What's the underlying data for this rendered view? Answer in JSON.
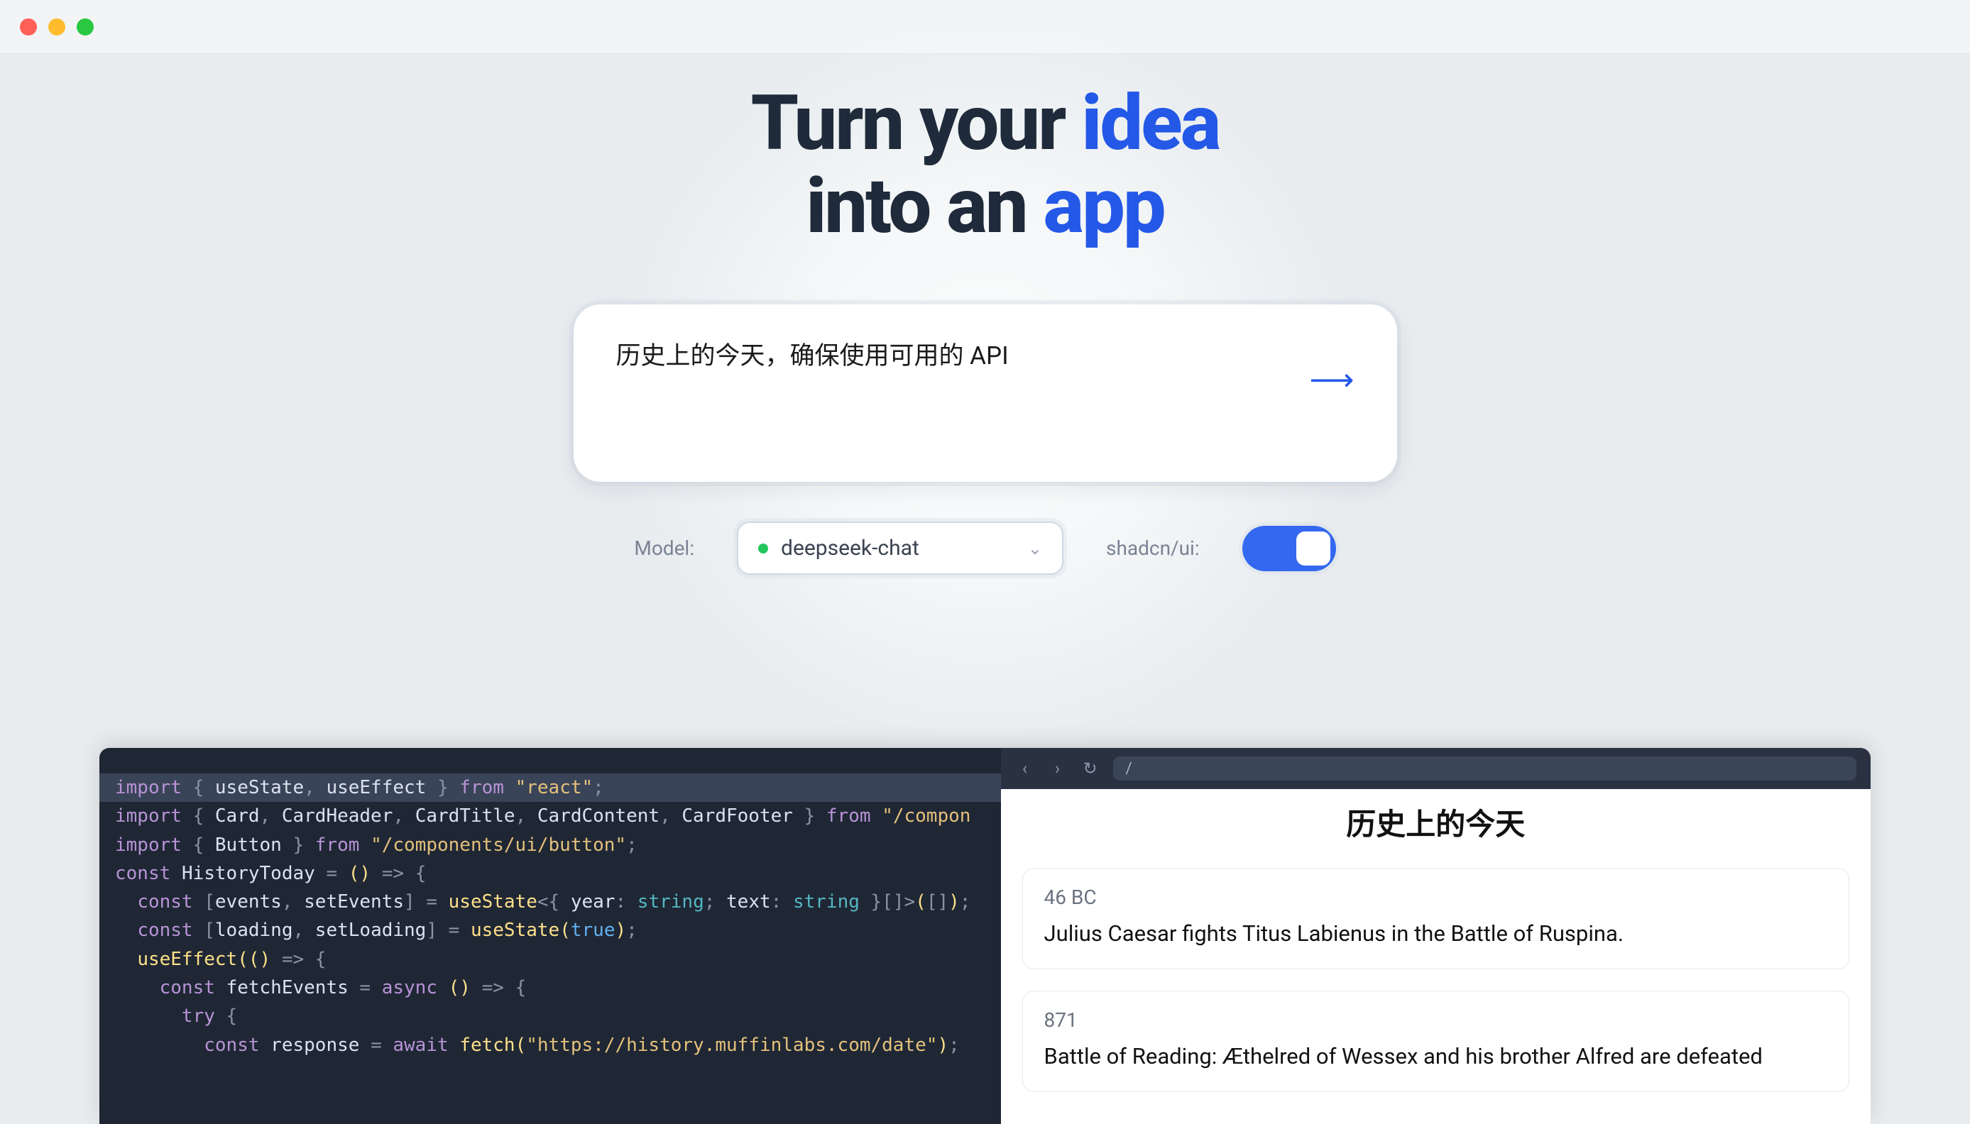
{
  "hero": {
    "line1_a": "Turn your ",
    "line1_b": "idea",
    "line2_a": "into an ",
    "line2_b": "app"
  },
  "prompt": {
    "text": "历史上的今天，确保使用可用的 API"
  },
  "controls": {
    "model_label": "Model:",
    "model_value": "deepseek-chat",
    "shadcn_label": "shadcn/ui:"
  },
  "code": {
    "lines": [
      {
        "hl": true,
        "tokens": [
          [
            "k-import",
            "import"
          ],
          [
            "",
            " "
          ],
          [
            "k-punct",
            "{"
          ],
          [
            "",
            " "
          ],
          [
            "k-var",
            "useState"
          ],
          [
            "k-punct",
            ","
          ],
          [
            "",
            " "
          ],
          [
            "k-var",
            "useEffect"
          ],
          [
            "",
            " "
          ],
          [
            "k-punct",
            "}"
          ],
          [
            "",
            " "
          ],
          [
            "k-from",
            "from"
          ],
          [
            "",
            " "
          ],
          [
            "k-str",
            "\"react\""
          ],
          [
            "k-punct",
            ";"
          ]
        ]
      },
      {
        "tokens": [
          [
            "k-import",
            "import"
          ],
          [
            "",
            " "
          ],
          [
            "k-punct",
            "{"
          ],
          [
            "",
            " "
          ],
          [
            "k-var",
            "Card"
          ],
          [
            "k-punct",
            ","
          ],
          [
            "",
            " "
          ],
          [
            "k-var",
            "CardHeader"
          ],
          [
            "k-punct",
            ","
          ],
          [
            "",
            " "
          ],
          [
            "k-var",
            "CardTitle"
          ],
          [
            "k-punct",
            ","
          ],
          [
            "",
            " "
          ],
          [
            "k-var",
            "CardContent"
          ],
          [
            "k-punct",
            ","
          ],
          [
            "",
            " "
          ],
          [
            "k-var",
            "CardFooter"
          ],
          [
            "",
            " "
          ],
          [
            "k-punct",
            "}"
          ],
          [
            "",
            " "
          ],
          [
            "k-from",
            "from"
          ],
          [
            "",
            " "
          ],
          [
            "k-str",
            "\"/compon"
          ]
        ]
      },
      {
        "tokens": [
          [
            "k-import",
            "import"
          ],
          [
            "",
            " "
          ],
          [
            "k-punct",
            "{"
          ],
          [
            "",
            " "
          ],
          [
            "k-var",
            "Button"
          ],
          [
            "",
            " "
          ],
          [
            "k-punct",
            "}"
          ],
          [
            "",
            " "
          ],
          [
            "k-from",
            "from"
          ],
          [
            "",
            " "
          ],
          [
            "k-str",
            "\"/components/ui/button\""
          ],
          [
            "k-punct",
            ";"
          ]
        ]
      },
      {
        "tokens": [
          [
            "",
            ""
          ]
        ]
      },
      {
        "tokens": [
          [
            "k-const",
            "const"
          ],
          [
            "",
            " "
          ],
          [
            "k-var",
            "HistoryToday"
          ],
          [
            "",
            " "
          ],
          [
            "k-punct",
            "="
          ],
          [
            "",
            " "
          ],
          [
            "k-paren",
            "()"
          ],
          [
            "",
            " "
          ],
          [
            "k-punct",
            "=>"
          ],
          [
            "",
            " "
          ],
          [
            "k-punct",
            "{"
          ]
        ]
      },
      {
        "tokens": [
          [
            "",
            "  "
          ],
          [
            "k-const",
            "const"
          ],
          [
            "",
            " "
          ],
          [
            "k-punct",
            "["
          ],
          [
            "k-var",
            "events"
          ],
          [
            "k-punct",
            ","
          ],
          [
            "",
            " "
          ],
          [
            "k-var",
            "setEvents"
          ],
          [
            "k-punct",
            "]"
          ],
          [
            "",
            " "
          ],
          [
            "k-punct",
            "="
          ],
          [
            "",
            " "
          ],
          [
            "k-fn",
            "useState"
          ],
          [
            "k-punct",
            "<"
          ],
          [
            "k-punct",
            "{"
          ],
          [
            "",
            " "
          ],
          [
            "k-var",
            "year"
          ],
          [
            "k-punct",
            ":"
          ],
          [
            "",
            " "
          ],
          [
            "k-type",
            "string"
          ],
          [
            "k-punct",
            ";"
          ],
          [
            "",
            " "
          ],
          [
            "k-var",
            "text"
          ],
          [
            "k-punct",
            ":"
          ],
          [
            "",
            " "
          ],
          [
            "k-type",
            "string"
          ],
          [
            "",
            " "
          ],
          [
            "k-punct",
            "}"
          ],
          [
            "k-punct",
            "[]"
          ],
          [
            "k-punct",
            ">"
          ],
          [
            "k-paren",
            "("
          ],
          [
            "k-punct",
            "[]"
          ],
          [
            "k-paren",
            ")"
          ],
          [
            "k-punct",
            ";"
          ]
        ]
      },
      {
        "tokens": [
          [
            "",
            "  "
          ],
          [
            "k-const",
            "const"
          ],
          [
            "",
            " "
          ],
          [
            "k-punct",
            "["
          ],
          [
            "k-var",
            "loading"
          ],
          [
            "k-punct",
            ","
          ],
          [
            "",
            " "
          ],
          [
            "k-var",
            "setLoading"
          ],
          [
            "k-punct",
            "]"
          ],
          [
            "",
            " "
          ],
          [
            "k-punct",
            "="
          ],
          [
            "",
            " "
          ],
          [
            "k-fn",
            "useState"
          ],
          [
            "k-paren",
            "("
          ],
          [
            "k-bool",
            "true"
          ],
          [
            "k-paren",
            ")"
          ],
          [
            "k-punct",
            ";"
          ]
        ]
      },
      {
        "tokens": [
          [
            "",
            ""
          ]
        ]
      },
      {
        "tokens": [
          [
            "",
            "  "
          ],
          [
            "k-fn",
            "useEffect"
          ],
          [
            "k-paren",
            "("
          ],
          [
            "k-paren",
            "()"
          ],
          [
            "",
            " "
          ],
          [
            "k-punct",
            "=>"
          ],
          [
            "",
            " "
          ],
          [
            "k-punct",
            "{"
          ]
        ]
      },
      {
        "tokens": [
          [
            "",
            "    "
          ],
          [
            "k-const",
            "const"
          ],
          [
            "",
            " "
          ],
          [
            "k-var",
            "fetchEvents"
          ],
          [
            "",
            " "
          ],
          [
            "k-punct",
            "="
          ],
          [
            "",
            " "
          ],
          [
            "k-kw",
            "async"
          ],
          [
            "",
            " "
          ],
          [
            "k-paren",
            "()"
          ],
          [
            "",
            " "
          ],
          [
            "k-punct",
            "=>"
          ],
          [
            "",
            " "
          ],
          [
            "k-punct",
            "{"
          ]
        ]
      },
      {
        "tokens": [
          [
            "",
            "      "
          ],
          [
            "k-kw",
            "try"
          ],
          [
            "",
            " "
          ],
          [
            "k-punct",
            "{"
          ]
        ]
      },
      {
        "tokens": [
          [
            "",
            "        "
          ],
          [
            "k-const",
            "const"
          ],
          [
            "",
            " "
          ],
          [
            "k-var",
            "response"
          ],
          [
            "",
            " "
          ],
          [
            "k-punct",
            "="
          ],
          [
            "",
            " "
          ],
          [
            "k-kw",
            "await"
          ],
          [
            "",
            " "
          ],
          [
            "k-fn",
            "fetch"
          ],
          [
            "k-paren",
            "("
          ],
          [
            "k-str",
            "\"https://history.muffinlabs.com/date\""
          ],
          [
            "k-paren",
            ")"
          ],
          [
            "k-punct",
            ";"
          ]
        ]
      }
    ]
  },
  "preview": {
    "url": "/",
    "title": "历史上的今天",
    "events": [
      {
        "year": "46 BC",
        "text": "Julius Caesar fights Titus Labienus in the Battle of Ruspina."
      },
      {
        "year": "871",
        "text": "Battle of Reading: Æthelred of Wessex and his brother Alfred are defeated"
      }
    ]
  }
}
